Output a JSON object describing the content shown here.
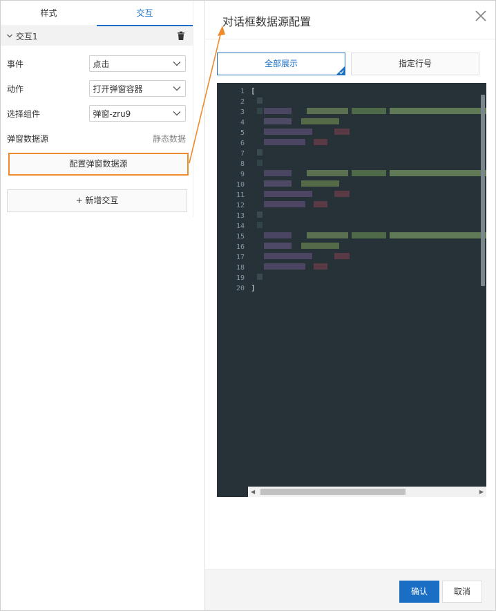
{
  "left_panel": {
    "tabs": [
      {
        "label": "样式",
        "active": false
      },
      {
        "label": "交互",
        "active": true
      }
    ],
    "section": {
      "title": "交互1",
      "icon": "trash-icon"
    },
    "fields": {
      "event": {
        "label": "事件",
        "value": "点击"
      },
      "action": {
        "label": "动作",
        "value": "打开弹窗容器"
      },
      "component": {
        "label": "选择组件",
        "value": "弹窗-zru9"
      },
      "datasource": {
        "label": "弹窗数据源",
        "value": "静态数据"
      }
    },
    "config_button": "配置弹窗数据源",
    "add_button": "+ 新增交互"
  },
  "dialog": {
    "title": "对话框数据源配置",
    "modes": [
      {
        "label": "全部展示",
        "active": true
      },
      {
        "label": "指定行号",
        "active": false
      }
    ],
    "editor": {
      "line_numbers": [
        "1",
        "2",
        "3",
        "4",
        "5",
        "6",
        "7",
        "8",
        "9",
        "10",
        "11",
        "12",
        "13",
        "14",
        "15",
        "16",
        "17",
        "18",
        "19",
        "20"
      ],
      "open_bracket": "[",
      "close_bracket": "]"
    },
    "footer": {
      "confirm": "确认",
      "cancel": "取消"
    }
  },
  "colors": {
    "accent": "#1a6fc4",
    "highlight": "#ef8b2c",
    "editor_bg": "#263238"
  }
}
